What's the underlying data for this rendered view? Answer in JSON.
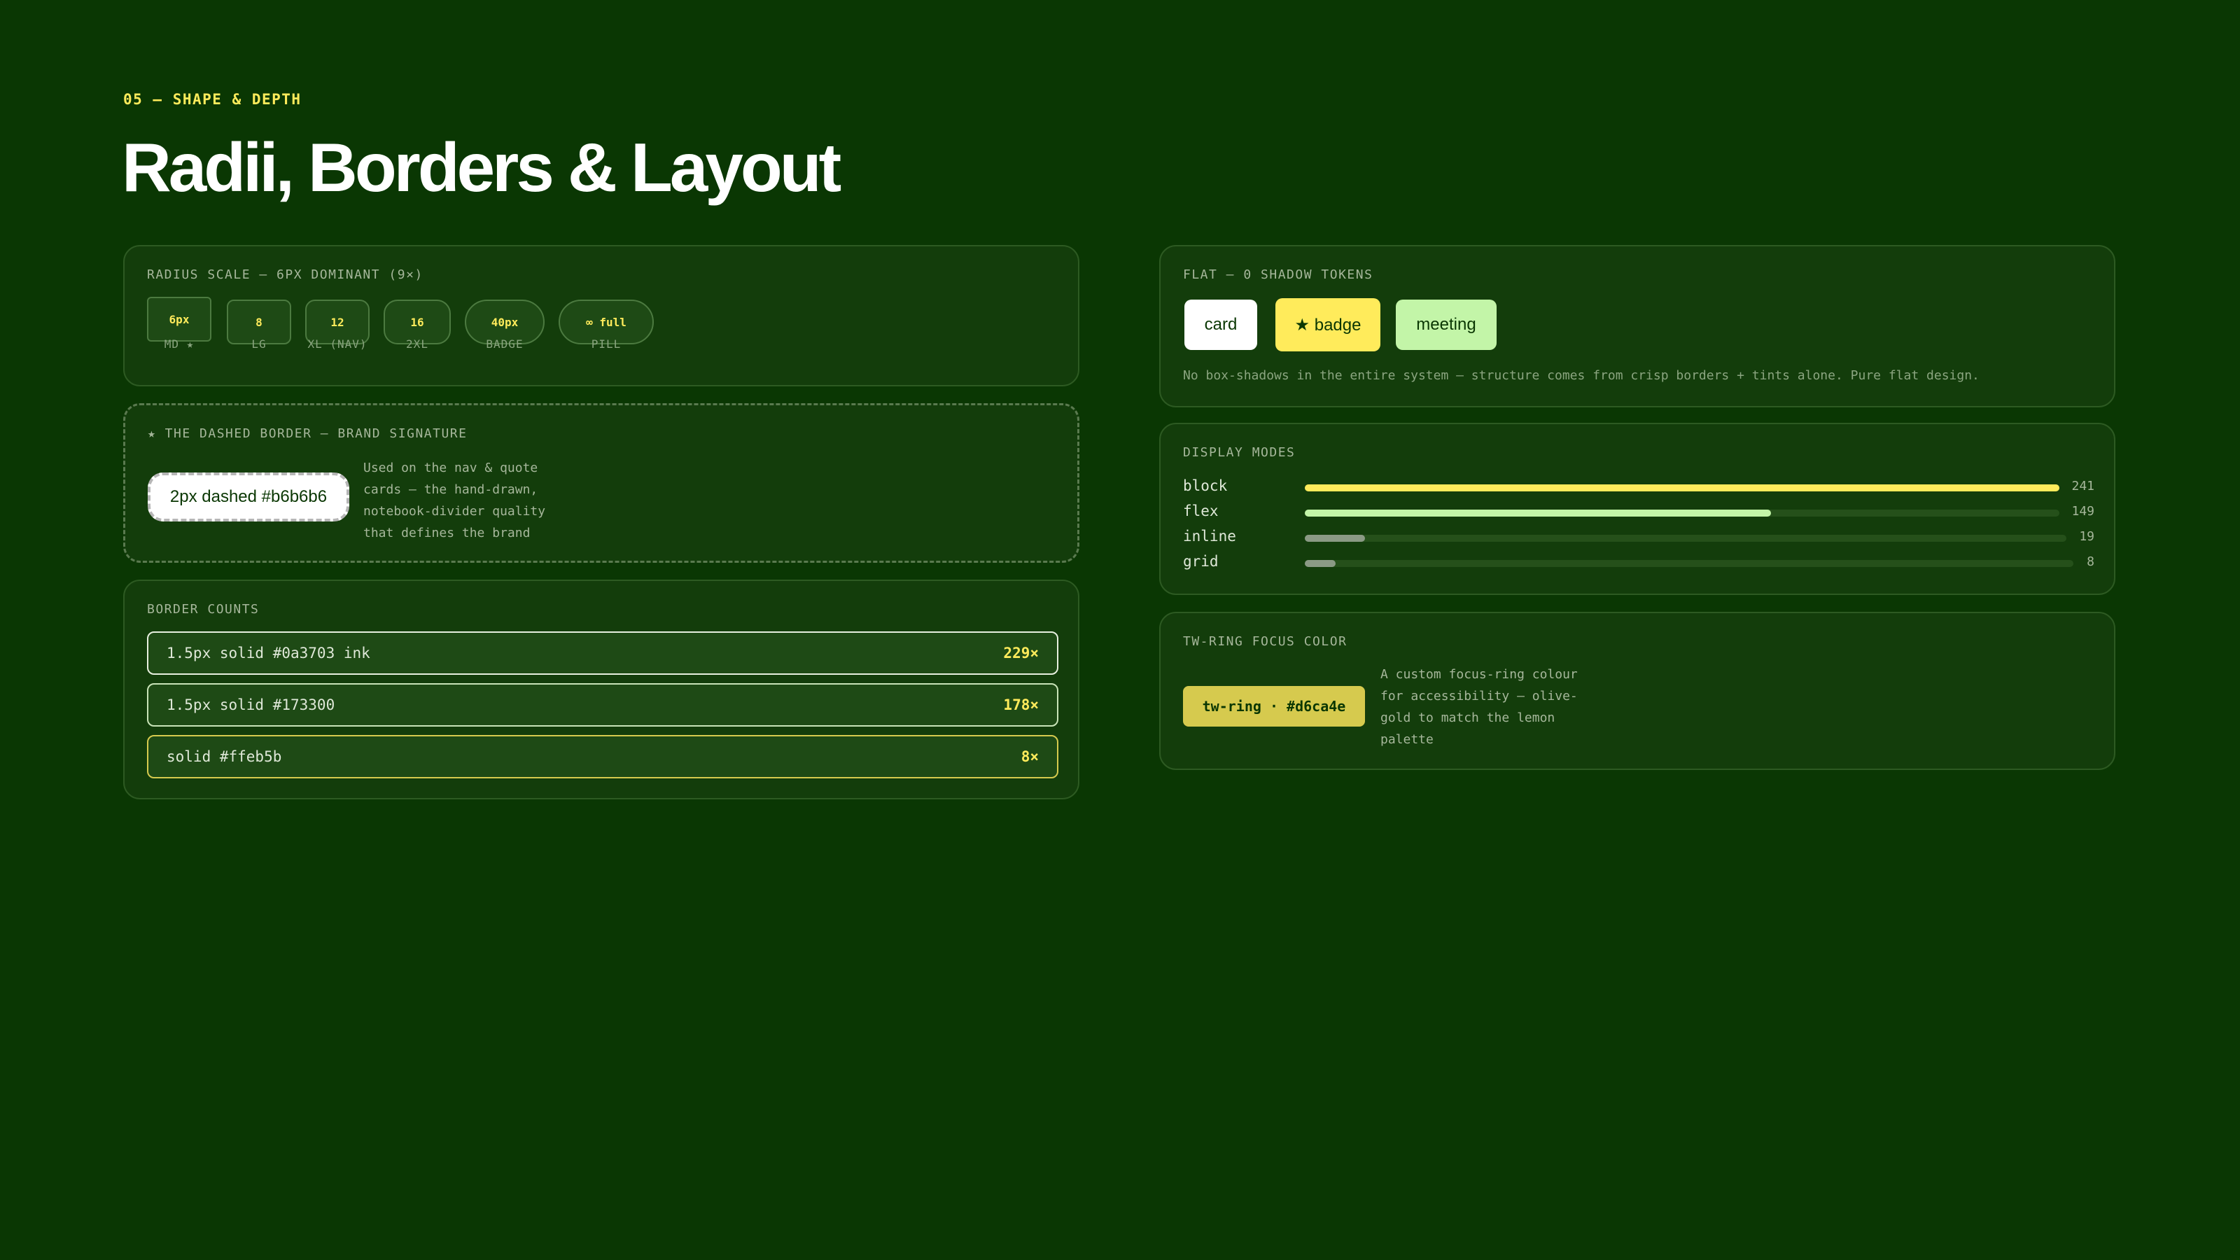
{
  "header": {
    "eyebrow": "05 — SHAPE & DEPTH",
    "title": "Radii, Borders & Layout"
  },
  "radius_scale": {
    "label": "RADIUS SCALE — 6PX DOMINANT (9×)",
    "chips": [
      {
        "value": "6px",
        "caption": "MD ★"
      },
      {
        "value": "8",
        "caption": "LG"
      },
      {
        "value": "12",
        "caption": "XL (NAV)"
      },
      {
        "value": "16",
        "caption": "2XL"
      },
      {
        "value": "40px",
        "caption": "BADGE"
      },
      {
        "value": "∞ full",
        "caption": "PILL"
      }
    ]
  },
  "dashed": {
    "label": "★ THE DASHED BORDER — BRAND SIGNATURE",
    "sample": "2px dashed #b6b6b6",
    "description": "Used on the nav & quote cards — the hand-drawn, notebook-divider quality that defines the brand"
  },
  "border_counts": {
    "label": "BORDER COUNTS",
    "rows": [
      {
        "spec": "1.5px solid #0a3703 ink",
        "count": "229×",
        "border_color": "#e8f0e0"
      },
      {
        "spec": "1.5px solid #173300",
        "count": "178×",
        "border_color": "#c9e4b8"
      },
      {
        "spec": "solid #ffeb5b",
        "count": "8×",
        "border_color": "#d6ca4e"
      }
    ]
  },
  "shadow_tokens": {
    "label": "FLAT — 0 SHADOW TOKENS",
    "tokens": [
      {
        "label": "card",
        "color": "#ffffff"
      },
      {
        "label": "★ badge",
        "color": "#ffeb5b"
      },
      {
        "label": "meeting",
        "color": "#c3f5a8"
      }
    ],
    "description": "No box-shadows in the entire system — structure comes from crisp borders + tints alone. Pure flat design."
  },
  "display_modes": {
    "label": "DISPLAY MODES",
    "modes": [
      {
        "name": "block",
        "value": 241,
        "display": "241",
        "color": "#ffeb5b"
      },
      {
        "name": "flex",
        "value": 149,
        "display": "149",
        "color": "#c3f5a8"
      },
      {
        "name": "inline",
        "value": 19,
        "display": "19",
        "color": "#8b9a85"
      },
      {
        "name": "grid",
        "value": 8,
        "display": "8",
        "color": "#8b9a85"
      }
    ],
    "max": 241
  },
  "focus_ring": {
    "label": "TW-RING FOCUS COLOR",
    "sample": "tw-ring · #d6ca4e",
    "description": "A custom focus-ring colour for accessibility — olive-gold to match the lemon palette"
  }
}
